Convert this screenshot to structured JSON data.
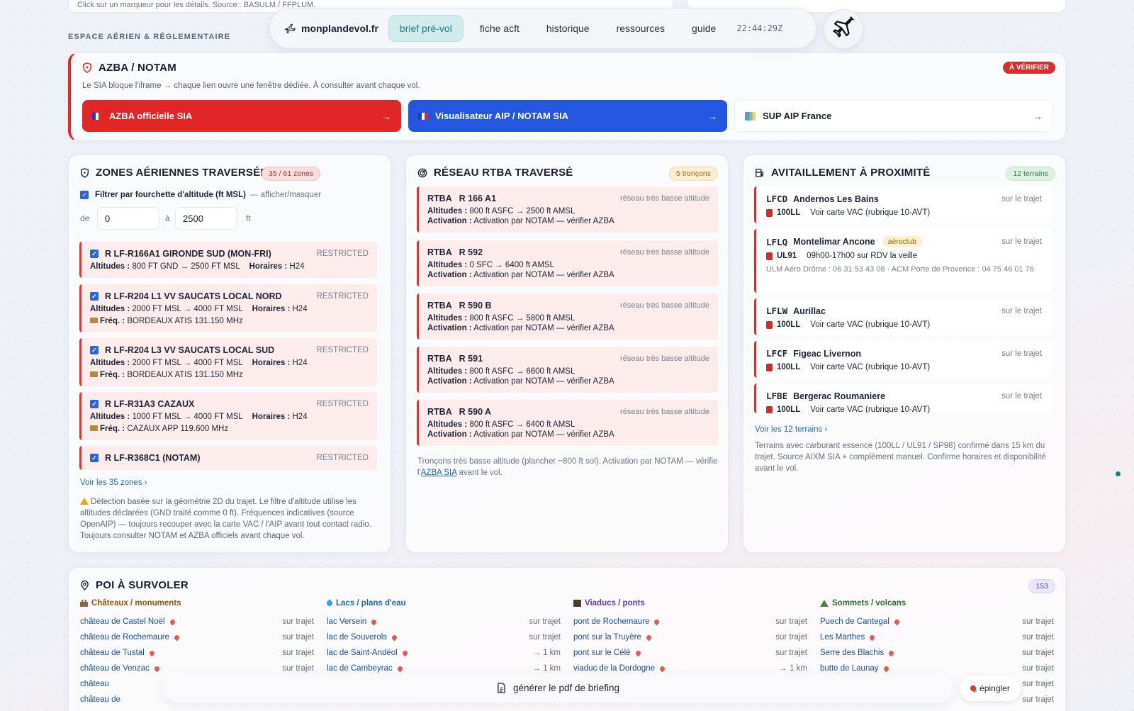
{
  "top_strip": {
    "left_text": "Click sur un marqueur pour les détails. Source : BASULM / FFPLUM."
  },
  "section_label": "ESPACE AÉRIEN & RÉGLEMENTAIRE",
  "nav": {
    "brand": "monplandevol.fr",
    "items": [
      "brief pré-vol",
      "fiche acft",
      "historique",
      "ressources",
      "guide"
    ],
    "active": "brief pré-vol",
    "time": "22:44:29Z"
  },
  "azba": {
    "title": "AZBA / NOTAM",
    "badge": "À VÉRIFIER",
    "subtitle": "Le SIA bloque l'iframe → chaque lien ouvre une fenêtre dédiée. À consulter avant chaque vol.",
    "buttons": [
      {
        "label": "AZBA officielle SIA",
        "arrow": "→"
      },
      {
        "label": "Visualisateur AIP / NOTAM SIA",
        "arrow": "→"
      },
      {
        "label": "SUP AIP France",
        "arrow": "→"
      }
    ]
  },
  "zones": {
    "title": "ZONES AÉRIENNES TRAVERSÉES",
    "badge": "35 / 61 zones",
    "filter_label": "Filtrer par fourchette d'altitude (ft MSL)",
    "filter_toggle": "— afficher/masquer",
    "from_label": "de",
    "from_value": "0",
    "to_label": "à",
    "to_value": "2500",
    "unit": "ft",
    "items": [
      {
        "name": "R  LF-R166A1 GIRONDE SUD (MON-FRI)",
        "type": "RESTRICTED",
        "alt": "800 FT GND → 2500 FT MSL",
        "hours": "H24",
        "freq": ""
      },
      {
        "name": "R  LF-R204 L1 VV SAUCATS LOCAL NORD",
        "type": "RESTRICTED",
        "alt": "2000 FT MSL → 4000 FT MSL",
        "hours": "H24",
        "freq": "BORDEAUX ATIS 131.150 MHz"
      },
      {
        "name": "R  LF-R204 L3 VV SAUCATS LOCAL SUD",
        "type": "RESTRICTED",
        "alt": "2000 FT MSL → 4000 FT MSL",
        "hours": "H24",
        "freq": "BORDEAUX ATIS 131.150 MHz"
      },
      {
        "name": "R  LF-R31A3 CAZAUX",
        "type": "RESTRICTED",
        "alt": "1000 FT MSL → 4000 FT MSL",
        "hours": "H24",
        "freq": "CAZAUX APP 119.600 MHz"
      },
      {
        "name": "R  LF-R368C1 (NOTAM)",
        "type": "RESTRICTED"
      }
    ],
    "labels": {
      "alt": "Altitudes :",
      "hours": "Horaires :",
      "freq": "Fréq. :"
    },
    "see_all": "Voir les 35 zones ›",
    "note": "Détection basée sur la géométrie 2D du trajet. Le filtre d'altitude utilise les altitudes déclarées (GND traité comme 0 ft). Fréquences indicatives (source OpenAIP) — toujours recouper avec la carte VAC / l'AIP avant tout contact radio. Toujours consulter NOTAM et AZBA officiels avant chaque vol."
  },
  "rtba": {
    "title": "RÉSEAU RTBA TRAVERSÉ",
    "badge": "5 tronçons",
    "items": [
      {
        "name": "RTBA   R 166 A1",
        "type": "réseau très basse altitude",
        "alt": "800 ft ASFC → 2500 ft AMSL",
        "act": "Activation par NOTAM — vérifier AZBA"
      },
      {
        "name": "RTBA   R 592",
        "type": "réseau très basse altitude",
        "alt": "0 SFC → 6400 ft AMSL",
        "act": "Activation par NOTAM — vérifier AZBA"
      },
      {
        "name": "RTBA   R 590 B",
        "type": "réseau très basse altitude",
        "alt": "800 ft ASFC → 5800 ft AMSL",
        "act": "Activation par NOTAM — vérifier AZBA"
      },
      {
        "name": "RTBA   R 591",
        "type": "réseau très basse altitude",
        "alt": "800 ft ASFC → 6600 ft AMSL",
        "act": "Activation par NOTAM — vérifier AZBA"
      },
      {
        "name": "RTBA   R 590 A",
        "type": "réseau très basse altitude",
        "alt": "800 ft ASFC → 6400 ft AMSL",
        "act": "Activation par NOTAM — vérifier AZBA"
      }
    ],
    "labels": {
      "alt": "Altitudes :",
      "act": "Activation :"
    },
    "note_a": "Tronçons très basse altitude (plancher ~800 ft sol). Activation par NOTAM — vérifie l'",
    "note_link": "AZBA SIA",
    "note_b": " avant le vol."
  },
  "fuel": {
    "title": "AVITAILLEMENT À PROXIMITÉ",
    "badge": "12 terrains",
    "items": [
      {
        "code": "LFCD",
        "name": "Andernos Les Bains",
        "tag": "",
        "where": "sur le trajet",
        "fuel": "100LL",
        "info": "Voir carte VAC (rubrique 10-AVT)",
        "extra": ""
      },
      {
        "code": "LFLQ",
        "name": "Montelimar Ancone",
        "tag": "aéroclub",
        "where": "sur le trajet",
        "fuel": "UL91",
        "info": "09h00-17h00 sur RDV la veille",
        "extra": "ULM Aéro Drôme : 06 31 53 43 08 · ACM Porte de Provence : 04 75 46 01 76"
      },
      {
        "code": "LFLW",
        "name": "Aurillac",
        "tag": "",
        "where": "sur le trajet",
        "fuel": "100LL",
        "info": "Voir carte VAC (rubrique 10-AVT)",
        "extra": ""
      },
      {
        "code": "LFCF",
        "name": "Figeac Livernon",
        "tag": "",
        "where": "sur le trajet",
        "fuel": "100LL",
        "info": "Voir carte VAC (rubrique 10-AVT)",
        "extra": ""
      },
      {
        "code": "LFBE",
        "name": "Bergerac Roumaniere",
        "tag": "",
        "where": "sur le trajet",
        "fuel": "100LL",
        "info": "Voir carte VAC (rubrique 10-AVT)",
        "extra": ""
      }
    ],
    "see_all": "Voir les 12 terrains ›",
    "note": "Terrains avec carburant essence (100LL / UL91 / SP98) confirmé dans 15 km du trajet. Source AIXM SIA + complément manuel. Confirme horaires et disponibilité avant le vol."
  },
  "poi": {
    "title": "POI À SURVOLER",
    "badge": "153",
    "cols": [
      {
        "title": "Châteaux / monuments",
        "color": "#8a5a12",
        "items": [
          {
            "n": "château de Castel Noël",
            "d": "sur trajet"
          },
          {
            "n": "château de Rochemaure",
            "d": "sur trajet"
          },
          {
            "n": "château de Tustal",
            "d": "sur trajet"
          },
          {
            "n": "château de Venzac",
            "d": "sur trajet"
          },
          {
            "n": "château",
            "d": ""
          },
          {
            "n": "château de",
            "d": ""
          }
        ]
      },
      {
        "title": "Lacs / plans d'eau",
        "color": "#1e6aa0",
        "items": [
          {
            "n": "lac Versein",
            "d": "sur trajet"
          },
          {
            "n": "lac de Souverols",
            "d": "sur trajet"
          },
          {
            "n": "lac de Saint-Andéol",
            "d": "→ 1 km"
          },
          {
            "n": "lac de Cambeyrac",
            "d": "→ 1 km"
          }
        ]
      },
      {
        "title": "Viaducs / ponts",
        "color": "#5b3fa8",
        "items": [
          {
            "n": "pont de Rochemaure",
            "d": "sur trajet"
          },
          {
            "n": "pont sur la Truyère",
            "d": "sur trajet"
          },
          {
            "n": "pont sur le Célé",
            "d": "sur trajet"
          },
          {
            "n": "viaduc de la Dordogne",
            "d": "→ 1 km"
          }
        ]
      },
      {
        "title": "Sommets / volcans",
        "color": "#2f6b2f",
        "items": [
          {
            "n": "Puech de Cantegal",
            "d": "sur trajet"
          },
          {
            "n": "Les Marthes",
            "d": "sur trajet"
          },
          {
            "n": "Serre des Blachis",
            "d": "sur trajet"
          },
          {
            "n": "butte de Launay",
            "d": "sur trajet"
          },
          {
            "n": "",
            "d": "sur trajet"
          },
          {
            "n": "",
            "d": "sur trajet"
          }
        ]
      }
    ]
  },
  "pdf_button": "générer le pdf de briefing",
  "pin_button": "épingler",
  "colors": {
    "red": "#d92c2c",
    "blue": "#2456e0",
    "teal": "#1f7d7f",
    "accent_bg": "#d2ecec"
  }
}
